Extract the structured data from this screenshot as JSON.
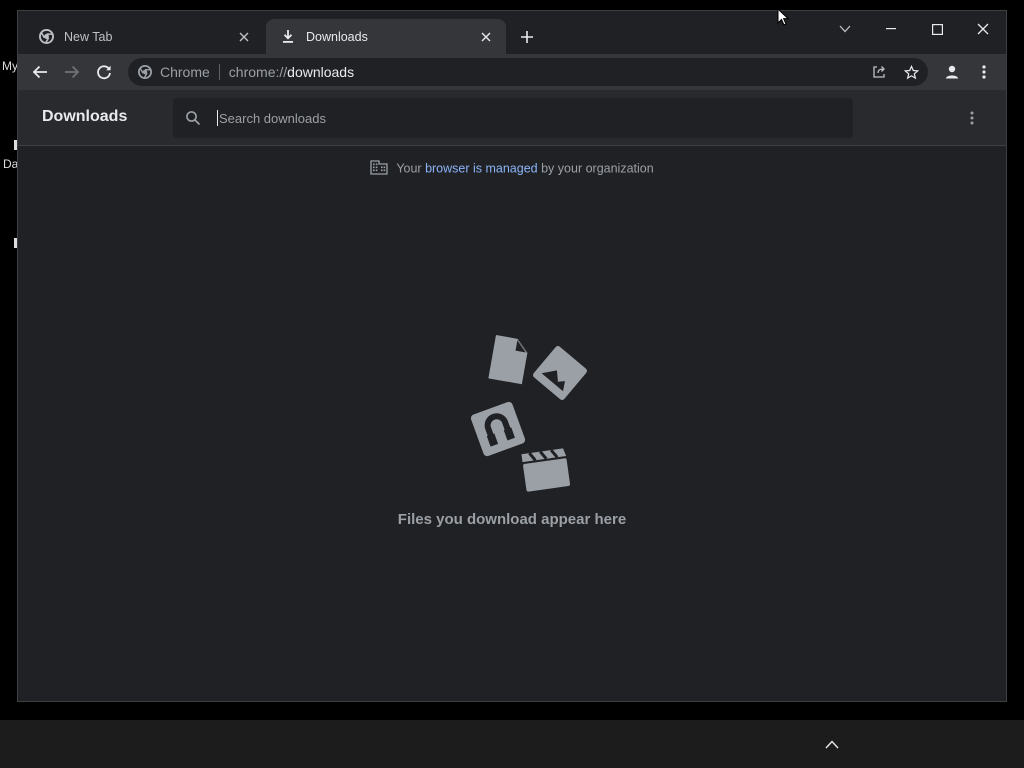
{
  "desktop": {
    "label_my": "My",
    "label_da": "Da"
  },
  "browser": {
    "tabs": [
      {
        "label": "New Tab",
        "icon": "chrome-icon",
        "active": false
      },
      {
        "label": "Downloads",
        "icon": "download-icon",
        "active": true
      }
    ],
    "omnibox": {
      "site_label": "Chrome",
      "url_prefix": "chrome://",
      "url_host": "downloads"
    }
  },
  "page": {
    "title": "Downloads",
    "search_placeholder": "Search downloads",
    "managed_prefix": "Your",
    "managed_link": "browser is managed",
    "managed_suffix": "by your organization",
    "empty_message": "Files you download appear here"
  },
  "colors": {
    "background": "#202124",
    "link": "#8ab4f8",
    "muted_text": "#9aa0a6"
  }
}
